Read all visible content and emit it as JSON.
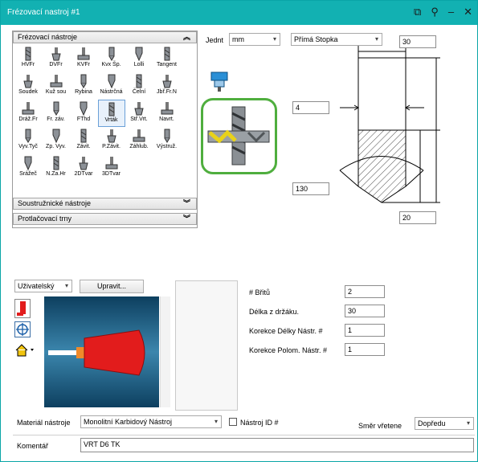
{
  "window": {
    "title": "Frézovací nastroj #1"
  },
  "sections": {
    "milling": "Frézovací nástroje",
    "turning": "Soustružnické nástroje",
    "broaching": "Protlačovací trny"
  },
  "tools": [
    "HVFr",
    "DVFr",
    "KVFr",
    "Kvx Šp.",
    "Lolli",
    "Tangent",
    "Soudek",
    "Kuž sou",
    "Rybina",
    "Nástrčná",
    "Čelní",
    "Jbř.Fr.N",
    "Dráž.Fr",
    "Fr. záv.",
    "FThd",
    "Vrták",
    "Stř.Vrt.",
    "Navrt.",
    "Vyv.Tyč",
    "Zp. Vyv.",
    "Závit.",
    "P.Závit.",
    "Záhlub.",
    "Výstruž.",
    "Srážeč",
    "N.Za.Hr",
    "2DTvar",
    "3DTvar"
  ],
  "units": {
    "label": "Jednt",
    "value": "mm"
  },
  "shank": {
    "value": "Přímá Stopka"
  },
  "dims": {
    "top": "30",
    "diameter": "4",
    "angle": "130",
    "bottom": "20"
  },
  "holder": {
    "type": "Uživatelský",
    "edit_label": "Upravit..."
  },
  "params": {
    "flutes_label": "# Břitů",
    "flutes": "2",
    "length_label": "Délka z držáku.",
    "length": "30",
    "len_corr_label": "Korekce Délky Nástr. #",
    "len_corr": "1",
    "rad_corr_label": "Korekce Polom. Nástr. #",
    "rad_corr": "1"
  },
  "material": {
    "label": "Materiál nástroje",
    "value": "Monolitní Karbidový Nástroj"
  },
  "tool_id": {
    "label": "Nástroj ID #"
  },
  "spindle": {
    "label": "Směr vřetene",
    "value": "Dopředu"
  },
  "comment": {
    "label": "Komentář",
    "value": "VRT D6 TK"
  },
  "colors": {
    "titlebar": "#12b1b2",
    "highlight": "#4fae3e",
    "preview_bg": "#1e6d8f",
    "holder": "#e21c1c"
  }
}
